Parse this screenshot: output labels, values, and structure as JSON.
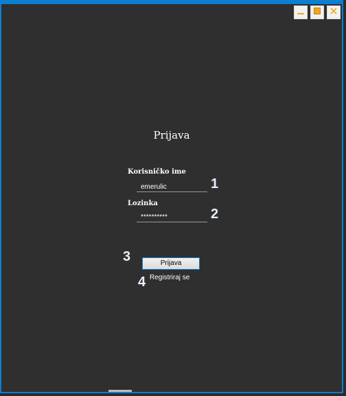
{
  "app": {
    "title": "Prijava"
  },
  "window_controls": {
    "minimize_icon": "minimize-icon",
    "maximize_icon": "maximize-icon",
    "close_icon": "close-icon",
    "accent": "#f2a71b",
    "close_color": "#f2a71b"
  },
  "form": {
    "username_label": "Korisničko ime",
    "username_value": "emerulic",
    "password_label": "Lozinka",
    "password_value": "**********",
    "login_button_label": "Prijava",
    "register_link_label": "Registriraj se"
  },
  "annotations": {
    "badge_1": "1",
    "badge_2": "2",
    "badge_3": "3",
    "badge_4": "4"
  },
  "colors": {
    "background": "#2f2f2f",
    "window_border": "#0b7fd1",
    "text": "#ffffff"
  }
}
